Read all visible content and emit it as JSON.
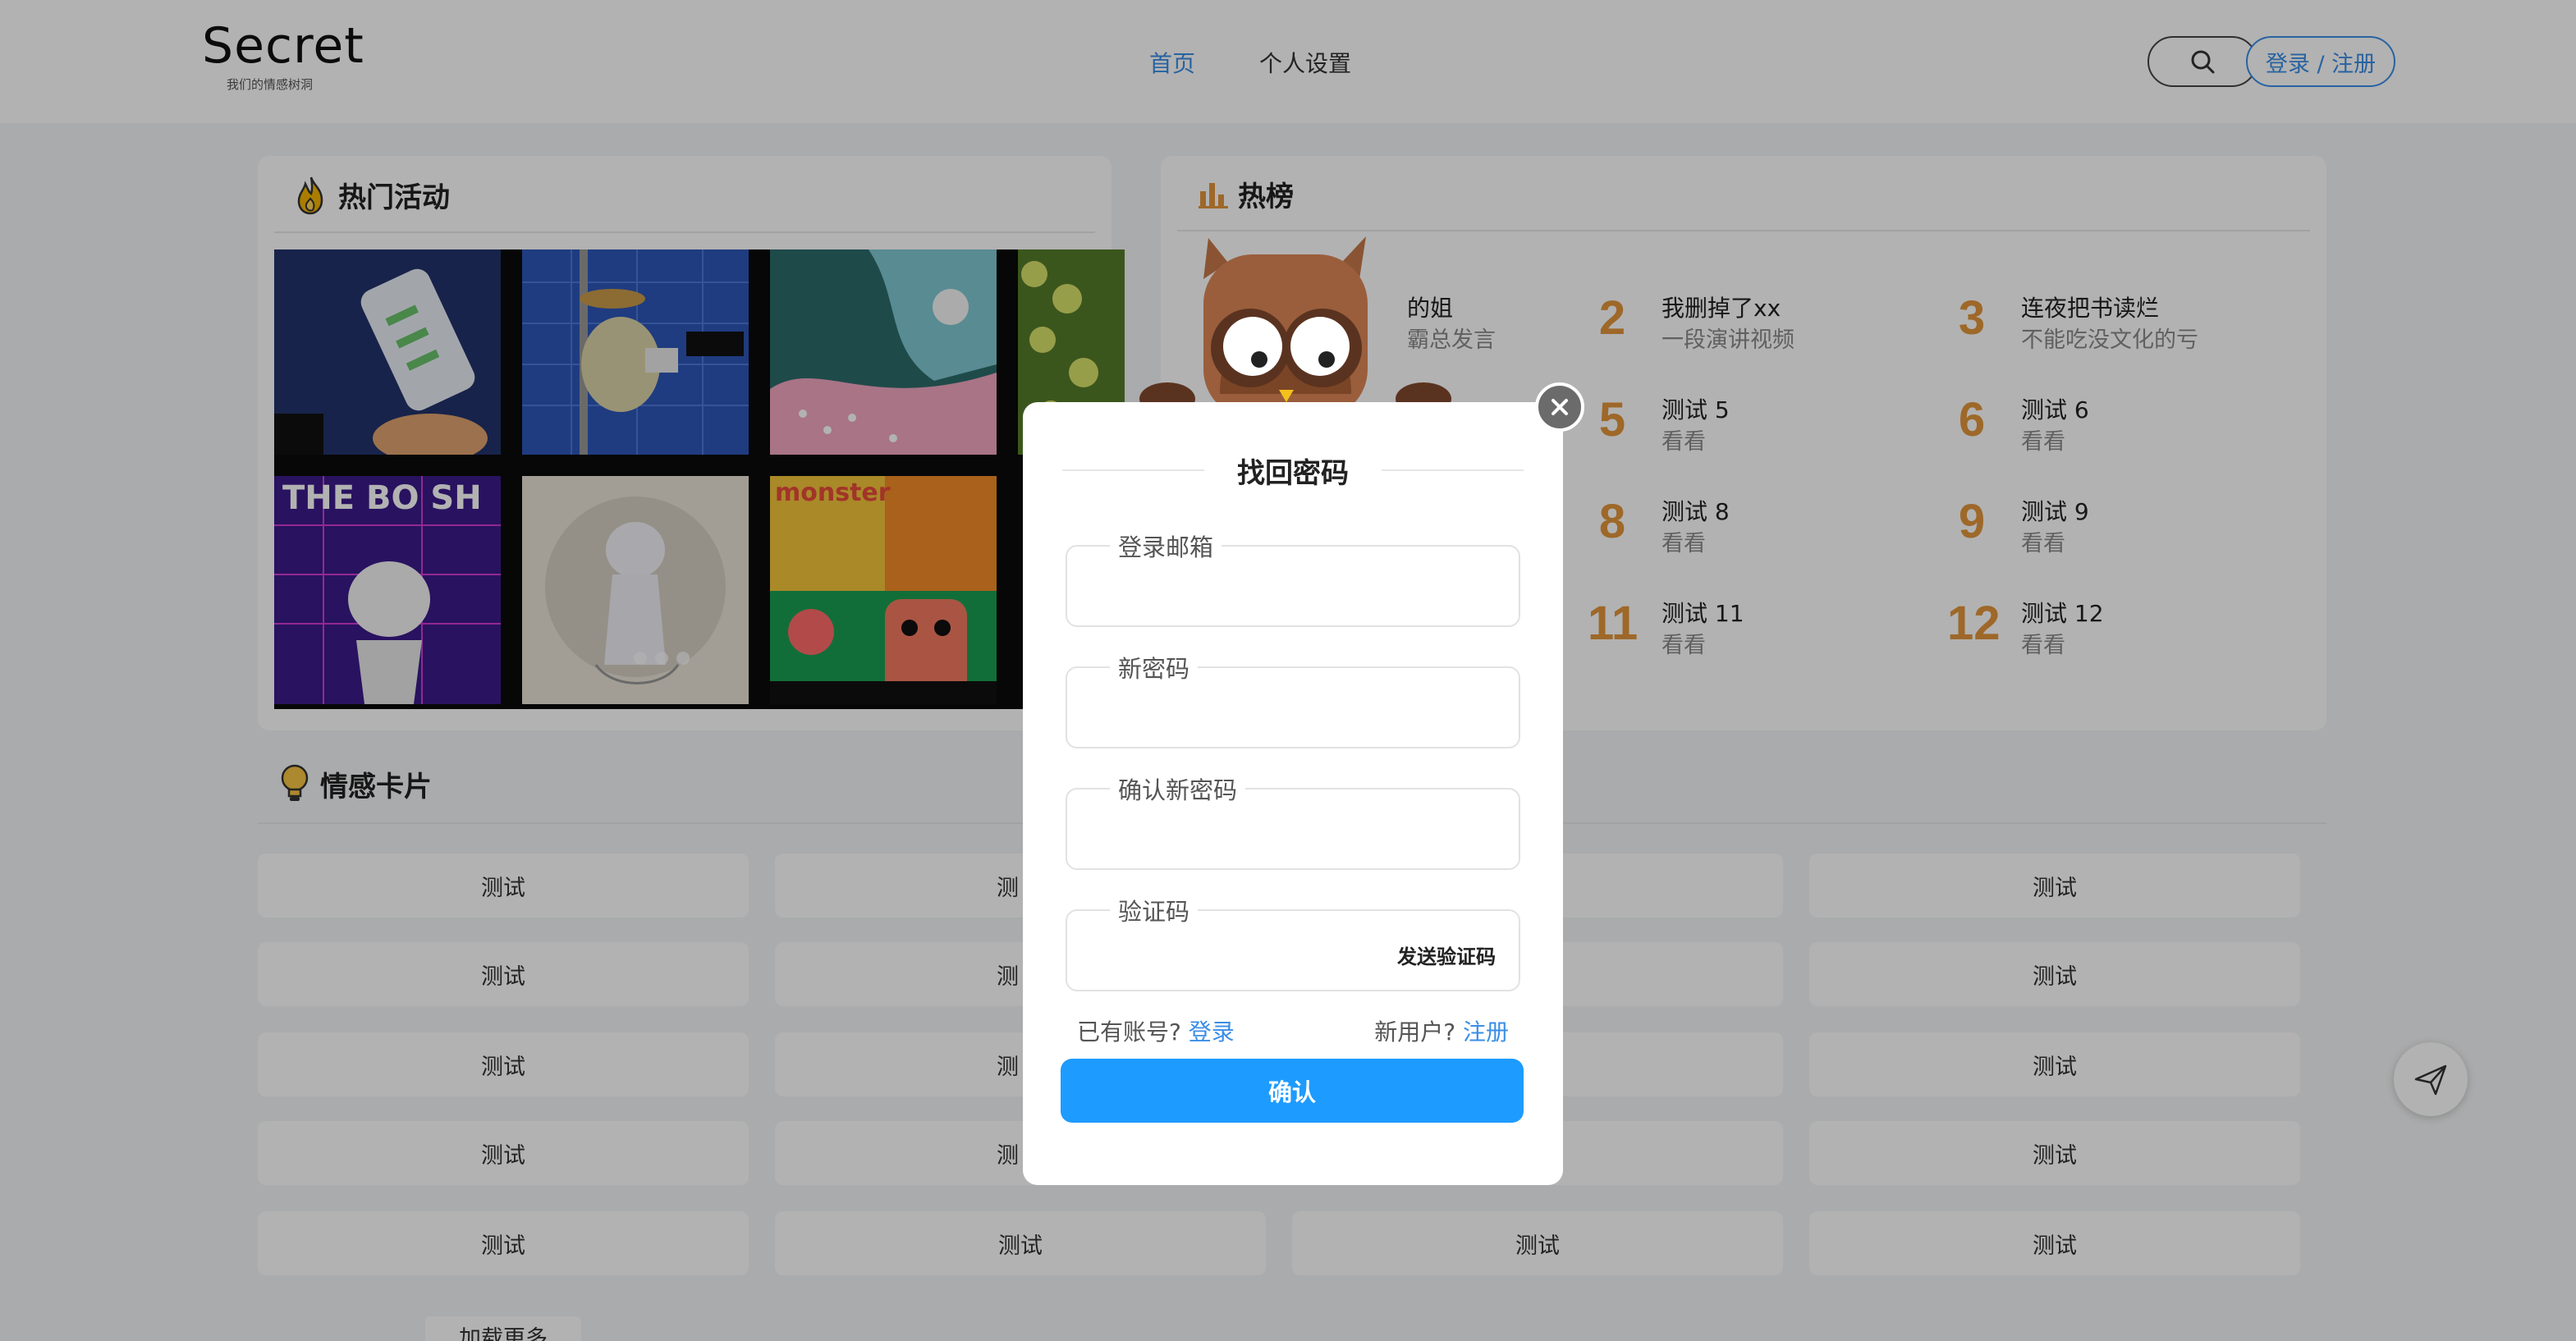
{
  "header": {
    "logo_title": "Secret",
    "logo_subtitle": "我们的情感树洞",
    "nav": [
      {
        "label": "首页",
        "active": true
      },
      {
        "label": "个人设置",
        "active": false
      }
    ],
    "search_icon": "search-icon",
    "login_label": "登录 / 注册"
  },
  "hot_activities": {
    "title": "热门活动",
    "icon": "fire-icon"
  },
  "hot_list": {
    "title": "热榜",
    "icon": "bar-chart-icon",
    "items": [
      {
        "rank": "",
        "title": "的姐",
        "sub": "霸总发言"
      },
      {
        "rank": "2",
        "title": "我删掉了xx",
        "sub": "一段演讲视频"
      },
      {
        "rank": "3",
        "title": "连夜把书读烂",
        "sub": "不能吃没文化的亏"
      },
      {
        "rank": "5",
        "title": "测试 5",
        "sub": "看看"
      },
      {
        "rank": "6",
        "title": "测试 6",
        "sub": "看看"
      },
      {
        "rank": "8",
        "title": "测试 8",
        "sub": "看看"
      },
      {
        "rank": "9",
        "title": "测试 9",
        "sub": "看看"
      },
      {
        "rank": "11",
        "title": "测试 11",
        "sub": "看看"
      },
      {
        "rank": "12",
        "title": "测试 12",
        "sub": "看看"
      }
    ]
  },
  "emotion_cards": {
    "title": "情感卡片",
    "icon": "lightbulb-icon",
    "col1": [
      "测试",
      "测试",
      "测试",
      "测试",
      "测试"
    ],
    "col2_last": "测试",
    "col3_last": "测试",
    "col4": [
      "测试",
      "测试",
      "测试",
      "测试",
      "测试"
    ],
    "partial_col2": [
      "测",
      "测",
      "测",
      "测"
    ],
    "load_more": "加载更多"
  },
  "modal": {
    "title": "找回密码",
    "email_label": "登录邮箱",
    "email_value": "",
    "new_password_label": "新密码",
    "new_password_value": "",
    "confirm_password_label": "确认新密码",
    "confirm_password_value": "",
    "code_label": "验证码",
    "code_value": "",
    "send_code": "发送验证码",
    "have_account": "已有账号?",
    "login_link": "登录",
    "new_user": "新用户?",
    "register_link": "注册",
    "confirm": "确认",
    "close_icon": "close-icon"
  },
  "fab_icon": "send-icon",
  "colors": {
    "accent": "#3a8ee6",
    "rank_orange": "#e2953b",
    "confirm_blue": "#1e9bff"
  }
}
